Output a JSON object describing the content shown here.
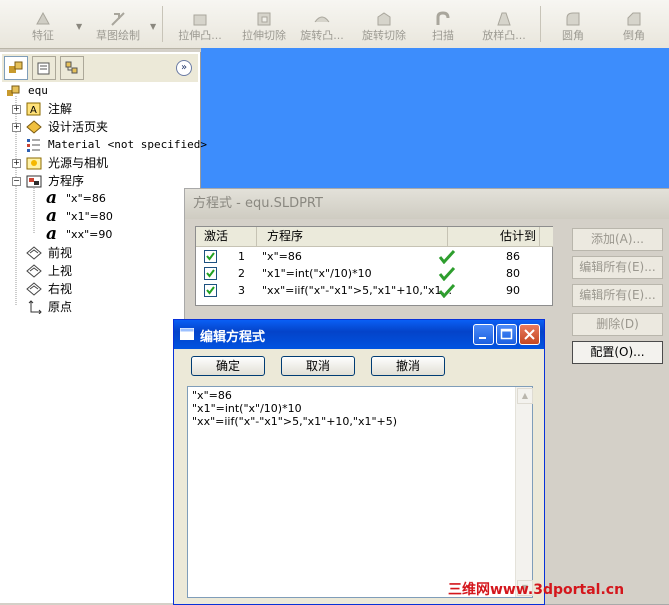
{
  "toolbar": {
    "items": [
      {
        "label": "特征",
        "icon": "feature-icon"
      },
      {
        "label": "草图绘制",
        "icon": "sketch-icon"
      },
      {
        "label": "拉伸凸...",
        "icon": "extrude-boss-icon"
      },
      {
        "label": "拉伸切除",
        "icon": "extrude-cut-icon"
      },
      {
        "label": "旋转凸...",
        "icon": "revolve-boss-icon"
      },
      {
        "label": "旋转切除",
        "icon": "revolve-cut-icon"
      },
      {
        "label": "扫描",
        "icon": "sweep-icon"
      },
      {
        "label": "放样凸...",
        "icon": "loft-icon"
      },
      {
        "label": "圆角",
        "icon": "fillet-icon"
      },
      {
        "label": "倒角",
        "icon": "chamfer-icon"
      }
    ]
  },
  "tree": {
    "root": "equ",
    "items": [
      {
        "label": "注解"
      },
      {
        "label": "设计活页夹"
      },
      {
        "label": "Material <not specified>"
      },
      {
        "label": "光源与相机"
      },
      {
        "label": "方程序"
      },
      {
        "label": "\"x\"=86"
      },
      {
        "label": "\"x1\"=80"
      },
      {
        "label": "\"xx\"=90"
      },
      {
        "label": "前视"
      },
      {
        "label": "上视"
      },
      {
        "label": "右视"
      },
      {
        "label": "原点"
      }
    ]
  },
  "equations_dialog": {
    "title": "方程式 - equ.SLDPRT",
    "columns": {
      "active": "激活",
      "equation": "方程序",
      "evaluates": "估计到"
    },
    "rows": [
      {
        "num": "1",
        "equation": "\"x\"=86",
        "value": "86"
      },
      {
        "num": "2",
        "equation": "\"x1\"=int(\"x\"/10)*10",
        "value": "80"
      },
      {
        "num": "3",
        "equation": "\"xx\"=iif(\"x\"-\"x1\">5,\"x1\"+10,\"x1...",
        "value": "90"
      }
    ],
    "buttons": {
      "add": "添加(A)...",
      "edit_all": "编辑所有(E)...",
      "edit_all2": "编辑所有(E)...",
      "delete": "删除(D)",
      "config": "配置(O)..."
    }
  },
  "edit_dialog": {
    "title": "编辑方程式",
    "ok": "确定",
    "cancel": "取消",
    "undo": "撤消",
    "lines": [
      "\"x\"=86",
      "\"x1\"=int(\"x\"/10)*10",
      "\"xx\"=iif(\"x\"-\"x1\">5,\"x1\"+10,\"x1\"+5)"
    ]
  },
  "watermark": "三维网www.3dportal.cn",
  "colors": {
    "viewport": "#3d8dfc",
    "xp_title": "#0153e0",
    "check": "#2e9e2e",
    "watermark": "#d4161c"
  }
}
